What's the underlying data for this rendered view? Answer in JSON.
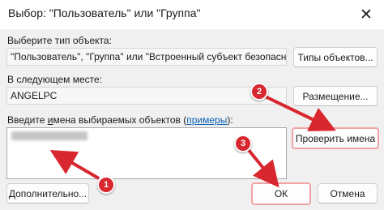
{
  "window": {
    "title": "Выбор: \"Пользователь\" или \"Группа\""
  },
  "object_type": {
    "label": "Выберите тип объекта:",
    "value": "\"Пользователь\", \"Группа\" или \"Встроенный субъект безопасности\"",
    "button": "Типы объектов..."
  },
  "location": {
    "label": "В следующем месте:",
    "value": "ANGELPC",
    "button": "Размещение..."
  },
  "names": {
    "label_prefix": "Введите ",
    "label_underlined": "и",
    "label_rest": "мена выбираемых объектов (",
    "examples_link": "примеры",
    "label_suffix": "):",
    "check_button": "Проверить имена"
  },
  "footer": {
    "advanced_button": "Дополнительно...",
    "ok_button": "ОК",
    "cancel_button": "Отмена"
  },
  "annotations": {
    "badges": [
      "1",
      "2",
      "3"
    ],
    "color": "#d8272e"
  }
}
